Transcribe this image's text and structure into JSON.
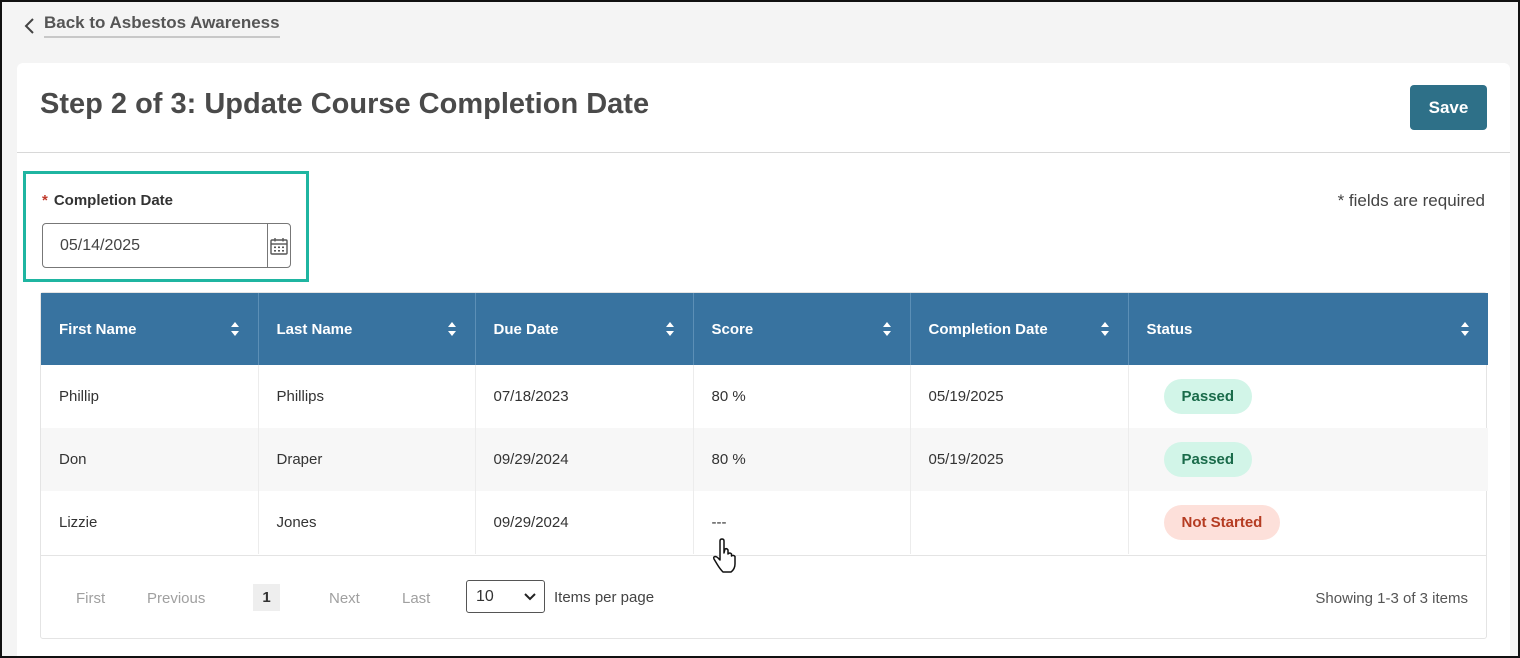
{
  "back_link": {
    "label": "Back to Asbestos Awareness"
  },
  "header": {
    "title": "Step 2 of 3: Update Course Completion Date",
    "save_label": "Save"
  },
  "completion_date": {
    "required_mark": "*",
    "label": "Completion Date",
    "value": "05/14/2025",
    "icon": "calendar-icon"
  },
  "required_note": "* fields are required",
  "table": {
    "columns": [
      "First Name",
      "Last Name",
      "Due Date",
      "Score",
      "Completion Date",
      "Status"
    ],
    "rows": [
      {
        "first": "Phillip",
        "last": "Phillips",
        "due": "07/18/2023",
        "score": "80 %",
        "completed": "05/19/2025",
        "status": "Passed"
      },
      {
        "first": "Don",
        "last": "Draper",
        "due": "09/29/2024",
        "score": "80 %",
        "completed": "05/19/2025",
        "status": "Passed"
      },
      {
        "first": "Lizzie",
        "last": "Jones",
        "due": "09/29/2024",
        "score": "---",
        "completed": "",
        "status": "Not Started"
      }
    ]
  },
  "pager": {
    "first": "First",
    "previous": "Previous",
    "current": "1",
    "next": "Next",
    "last": "Last",
    "per_page_value": "10",
    "per_page_label": "Items per page",
    "showing": "Showing 1-3 of 3 items"
  },
  "colors": {
    "header_bg": "#3873a0",
    "save_bg": "#2e7088",
    "highlight": "#1fb5a1",
    "passed_bg": "#d2f5e8",
    "not_started_bg": "#fde0da"
  }
}
